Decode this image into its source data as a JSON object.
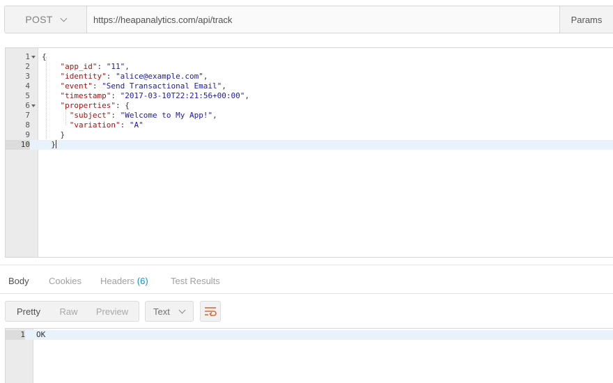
{
  "request": {
    "method": "POST",
    "url": "https://heapanalytics.com/api/track",
    "params_label": "Params"
  },
  "body_lines": [
    {
      "n": "1",
      "fold": true,
      "parts": [
        [
          "p",
          "{"
        ]
      ]
    },
    {
      "n": "2",
      "parts": [
        [
          "p",
          "    "
        ],
        [
          "k",
          "\"app_id\""
        ],
        [
          "p",
          ": "
        ],
        [
          "s",
          "\"11\""
        ],
        [
          "p",
          ","
        ]
      ]
    },
    {
      "n": "3",
      "parts": [
        [
          "p",
          "    "
        ],
        [
          "k",
          "\"identity\""
        ],
        [
          "p",
          ": "
        ],
        [
          "s",
          "\"alice@example.com\""
        ],
        [
          "p",
          ","
        ]
      ]
    },
    {
      "n": "4",
      "parts": [
        [
          "p",
          "    "
        ],
        [
          "k",
          "\"event\""
        ],
        [
          "p",
          ": "
        ],
        [
          "s",
          "\"Send Transactional Email\""
        ],
        [
          "p",
          ","
        ]
      ]
    },
    {
      "n": "5",
      "parts": [
        [
          "p",
          "    "
        ],
        [
          "k",
          "\"timestamp\""
        ],
        [
          "p",
          ": "
        ],
        [
          "s",
          "\"2017-03-10T22:21:56+00:00\""
        ],
        [
          "p",
          ","
        ]
      ]
    },
    {
      "n": "6",
      "fold": true,
      "parts": [
        [
          "p",
          "    "
        ],
        [
          "k",
          "\"properties\""
        ],
        [
          "p",
          ": {"
        ]
      ]
    },
    {
      "n": "7",
      "parts": [
        [
          "p",
          "      "
        ],
        [
          "k",
          "\"subject\""
        ],
        [
          "p",
          ": "
        ],
        [
          "s",
          "\"Welcome to My App!\""
        ],
        [
          "p",
          ","
        ]
      ]
    },
    {
      "n": "8",
      "parts": [
        [
          "p",
          "      "
        ],
        [
          "k",
          "\"variation\""
        ],
        [
          "p",
          ": "
        ],
        [
          "s",
          "\"A\""
        ]
      ]
    },
    {
      "n": "9",
      "parts": [
        [
          "p",
          "    }"
        ]
      ]
    },
    {
      "n": "10",
      "active": true,
      "cursor": true,
      "parts": [
        [
          "p",
          "  }"
        ]
      ]
    }
  ],
  "response": {
    "tabs": [
      {
        "label": "Body",
        "active": true
      },
      {
        "label": "Cookies"
      },
      {
        "label": "Headers",
        "count": "(6)"
      },
      {
        "label": "Test Results"
      }
    ],
    "view_modes": [
      {
        "label": "Pretty",
        "active": true
      },
      {
        "label": "Raw"
      },
      {
        "label": "Preview"
      }
    ],
    "format": "Text",
    "wrap_icon": "wrap-lines-icon",
    "lines": [
      {
        "n": "1",
        "text": "OK"
      }
    ]
  },
  "colors": {
    "accent_orange": "#e8652e",
    "link_blue": "#0f8ecf",
    "json_key": "#a31515",
    "json_string": "#1a1aa6"
  }
}
